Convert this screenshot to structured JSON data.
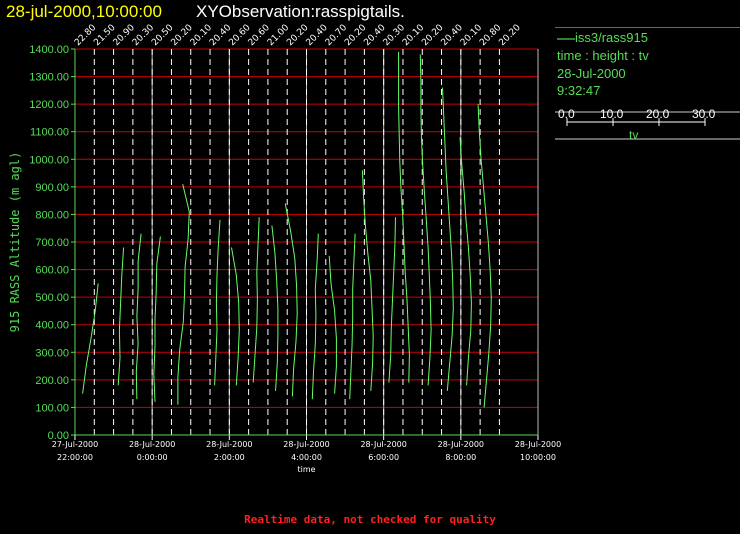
{
  "header": {
    "date_time": "28-jul-2000,10:00:00",
    "observation": "XYObservation:rasspigtails."
  },
  "legend": {
    "series_line": "iss3/rass915",
    "axes_line": "time : height : tv",
    "date_line": "28-Jul-2000",
    "time_line": "9:32:47",
    "scale_ticks": [
      "0.0",
      "10.0",
      "20.0",
      "30.0"
    ],
    "scale_label": "tv"
  },
  "footer": {
    "note": "Realtime data, not checked for quality"
  },
  "colors": {
    "title_date": "#ffff00",
    "title_obs": "#ffffff",
    "axis": "#55dd55",
    "grid": "#cc0000",
    "profile": "#66ff66",
    "time_markers": "#ffffff",
    "footer": "#ff2020"
  },
  "chart_data": {
    "type": "line",
    "xlabel": "time",
    "ylabel": "915 RASS Altitude (m agl)",
    "ylim": [
      0,
      1400
    ],
    "yticks": [
      "0.00",
      "100.00",
      "200.00",
      "300.00",
      "400.00",
      "500.00",
      "600.00",
      "700.00",
      "800.00",
      "900.00",
      "1000.00",
      "1100.00",
      "1200.00",
      "1300.00",
      "1400.00"
    ],
    "xlim": [
      "2000-07-27 22:00",
      "2000-07-28 10:00"
    ],
    "xticks": [
      {
        "time": "2000-07-27 22:00",
        "date": "27-Jul-2000",
        "clock": "22:00:00"
      },
      {
        "time": "2000-07-28 00:00",
        "date": "28-Jul-2000",
        "clock": "0:00:00"
      },
      {
        "time": "2000-07-28 02:00",
        "date": "28-Jul-2000",
        "clock": "2:00:00"
      },
      {
        "time": "2000-07-28 04:00",
        "date": "28-Jul-2000",
        "clock": "4:00:00"
      },
      {
        "time": "2000-07-28 06:00",
        "date": "28-Jul-2000",
        "clock": "6:00:00"
      },
      {
        "time": "2000-07-28 08:00",
        "date": "28-Jul-2000",
        "clock": "8:00:00"
      },
      {
        "time": "2000-07-28 10:00",
        "date": "28-Jul-2000",
        "clock": "10:00:00"
      }
    ],
    "grid": true,
    "profiles": [
      {
        "time": "2000-07-27 22:00",
        "label": "22.80",
        "top": 550,
        "tv": [
          22.8,
          22.3,
          21.6,
          20.8,
          20.2,
          19.6
        ]
      },
      {
        "time": "2000-07-27 22:30",
        "label": "21.50",
        "top": 0,
        "tv": []
      },
      {
        "time": "2000-07-27 23:00",
        "label": "20.90",
        "top": 680,
        "tv": [
          20.9,
          20.6,
          20.4,
          20.2,
          20.3,
          20.0,
          19.9
        ]
      },
      {
        "time": "2000-07-27 23:30",
        "label": "20.30",
        "top": 730,
        "tv": [
          20.3,
          19.8,
          19.8,
          19.6,
          19.8,
          19.5,
          19.6,
          19.6
        ]
      },
      {
        "time": "2000-07-28 00:00",
        "label": "20.50",
        "top": 720,
        "tv": [
          20.5,
          19.9,
          19.8,
          19.6,
          19.6,
          19.4,
          19.6,
          19.8
        ]
      },
      {
        "time": "2000-07-28 00:30",
        "label": "20.20",
        "top": 910,
        "tv": [
          20.2,
          21.3,
          21.1,
          20.6,
          20.5,
          20.3,
          19.7,
          19.4,
          19.4,
          19.0
        ]
      },
      {
        "time": "2000-07-28 01:00",
        "label": "20.10",
        "top": 0,
        "tv": []
      },
      {
        "time": "2000-07-28 01:30",
        "label": "20.40",
        "top": 780,
        "tv": [
          20.4,
          20.1,
          19.9,
          19.8,
          19.9,
          19.7,
          19.5,
          19.4
        ]
      },
      {
        "time": "2000-07-28 02:00",
        "label": "20.60",
        "top": 680,
        "tv": [
          20.6,
          21.4,
          21.8,
          21.9,
          21.7,
          21.4,
          20.9
        ]
      },
      {
        "time": "2000-07-28 02:30",
        "label": "20.60",
        "top": 790,
        "tv": [
          20.6,
          20.4,
          20.2,
          20.3,
          20.2,
          19.9,
          19.6,
          19.5
        ]
      },
      {
        "time": "2000-07-28 03:00",
        "label": "21.00",
        "top": 760,
        "tv": [
          21.0,
          21.5,
          21.8,
          22.0,
          22.0,
          21.9,
          21.6,
          21.0
        ]
      },
      {
        "time": "2000-07-28 03:30",
        "label": "20.20",
        "top": 840,
        "tv": [
          20.2,
          21.1,
          21.8,
          22.1,
          22.2,
          22.0,
          21.6,
          21.4,
          21.2
        ]
      },
      {
        "time": "2000-07-28 04:00",
        "label": "20.40",
        "top": 730,
        "tv": [
          20.4,
          20.2,
          19.9,
          20.0,
          19.9,
          19.6,
          19.4,
          19.1
        ]
      },
      {
        "time": "2000-07-28 04:30",
        "label": "20.70",
        "top": 650,
        "tv": [
          20.7,
          21.0,
          21.6,
          21.9,
          21.9,
          21.6,
          20.8
        ]
      },
      {
        "time": "2000-07-28 05:00",
        "label": "20.20",
        "top": 730,
        "tv": [
          20.2,
          20.0,
          19.8,
          19.8,
          19.7,
          19.5,
          19.3,
          19.2
        ]
      },
      {
        "time": "2000-07-28 05:30",
        "label": "20.40",
        "top": 960,
        "tv": [
          20.4,
          20.6,
          20.9,
          21.3,
          21.8,
          22.0,
          22.2,
          22.1,
          21.8,
          21.4
        ]
      },
      {
        "time": "2000-07-28 06:00",
        "label": "20.30",
        "top": 790,
        "tv": [
          20.3,
          20.2,
          20.0,
          19.8,
          19.6,
          19.5,
          19.2,
          19.0
        ]
      },
      {
        "time": "2000-07-28 06:30",
        "label": "20.10",
        "top": 1390,
        "tv": [
          20.1,
          20.1,
          20.1,
          20.2,
          20.3,
          20.5,
          20.8,
          21.0,
          21.2,
          21.5,
          21.7,
          21.9,
          21.8,
          21.5
        ]
      },
      {
        "time": "2000-07-28 07:00",
        "label": "20.20",
        "top": 1380,
        "tv": [
          20.2,
          20.3,
          20.3,
          20.4,
          20.6,
          20.9,
          21.2,
          21.5,
          21.7,
          21.9,
          22.0,
          21.8,
          21.5,
          21.2
        ]
      },
      {
        "time": "2000-07-28 07:30",
        "label": "20.40",
        "top": 1260,
        "tv": [
          20.4,
          20.6,
          20.8,
          21.0,
          21.3,
          21.6,
          21.9,
          22.1,
          22.2,
          22.0,
          21.6,
          21.2,
          20.9
        ]
      },
      {
        "time": "2000-07-28 08:00",
        "label": "20.10",
        "top": 1080,
        "tv": [
          20.1,
          20.4,
          20.8,
          21.1,
          21.5,
          21.8,
          22.0,
          21.9,
          21.5,
          21.2,
          20.9
        ]
      },
      {
        "time": "2000-07-28 08:30",
        "label": "20.80",
        "top": 1200,
        "tv": [
          20.8,
          21.0,
          21.3,
          21.7,
          22.1,
          22.5,
          22.8,
          23.0,
          22.9,
          22.6,
          22.2,
          21.8
        ]
      },
      {
        "time": "2000-07-28 09:00",
        "label": "20.20",
        "top": 0,
        "tv": []
      }
    ]
  }
}
